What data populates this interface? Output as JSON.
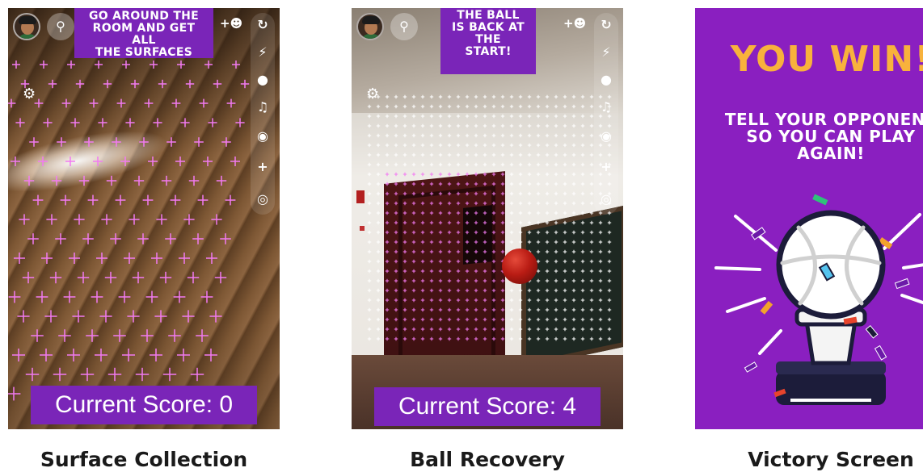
{
  "panels": [
    {
      "instruction": "GO AROUND THE\nROOM AND GET ALL\nTHE SURFACES",
      "score_label": "Current Score: 0",
      "caption": "Surface Collection"
    },
    {
      "instruction": "THE BALL\nIS BACK AT\nTHE\nSTART!",
      "score_label": "Current Score: 4",
      "caption": "Ball Recovery"
    },
    {
      "win_title": "YOU WIN!",
      "win_subtitle": "TELL YOUR OPPONENT\nSO YOU CAN PLAY\nAGAIN!",
      "caption": "Victory Screen"
    }
  ],
  "toolbar_icons": [
    "flip-camera-icon",
    "flash-off-icon",
    "video-icon",
    "music-icon",
    "camera-timer-icon",
    "plus-icon",
    "scan-icon"
  ],
  "colors": {
    "accent_purple": "#7a25b8",
    "victory_bg": "#8a1fc0",
    "win_yellow": "#f8b23c",
    "ball_red": "#b91c14",
    "surface_marks_pink": "#f27af2"
  }
}
